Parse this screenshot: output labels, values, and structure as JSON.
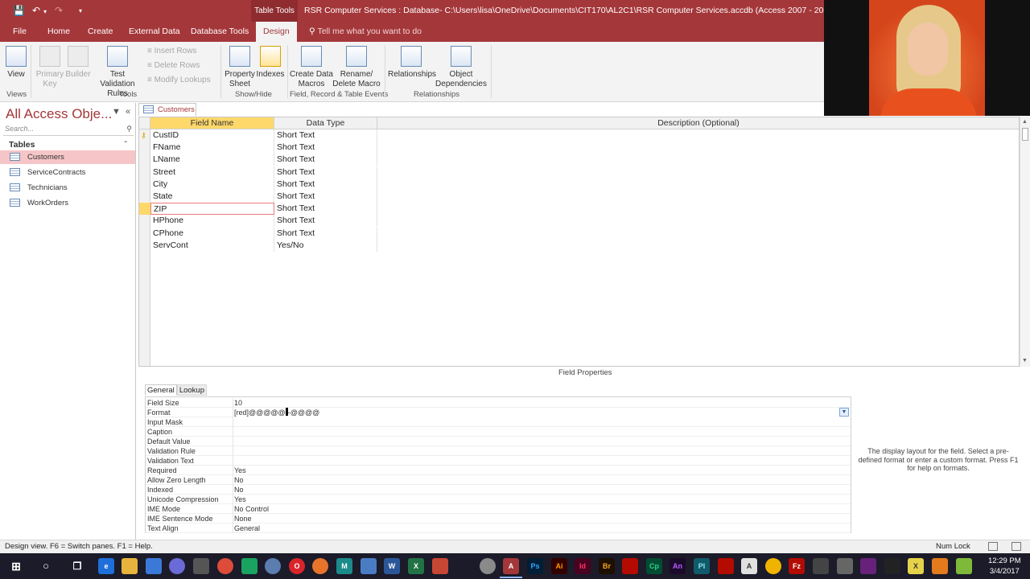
{
  "title_bar": {
    "context_tab": "Table Tools",
    "title": "RSR Computer Services : Database- C:\\Users\\lisa\\OneDrive\\Documents\\CIT170\\AL2C1\\RSR Computer Services.accdb (Access 2007 - 2016 file format) - Ac"
  },
  "ribbon_tabs": [
    "File",
    "Home",
    "Create",
    "External Data",
    "Database Tools",
    "Design"
  ],
  "tell_me": "Tell me what you want to do",
  "ribbon": {
    "view": "View",
    "primary_key": "Primary Key",
    "builder": "Builder",
    "test_validation": "Test Validation Rules",
    "insert_rows": "Insert Rows",
    "delete_rows": "Delete Rows",
    "modify_lookups": "Modify Lookups",
    "property_sheet": "Property Sheet",
    "indexes": "Indexes",
    "create_data_macros": "Create Data Macros",
    "rename_delete_macro": "Rename/ Delete Macro",
    "relationships": "Relationships",
    "object_dependencies": "Object Dependencies",
    "groups": {
      "views": "Views",
      "tools": "Tools",
      "show_hide": "Show/Hide",
      "events": "Field, Record & Table Events",
      "relationships": "Relationships"
    }
  },
  "nav": {
    "title": "All Access Obje...",
    "search_placeholder": "Search...",
    "section": "Tables",
    "items": [
      "Customers",
      "ServiceContracts",
      "Technicians",
      "WorkOrders"
    ],
    "selected": "Customers"
  },
  "doc_tab": "Customers",
  "grid": {
    "headers": [
      "Field Name",
      "Data Type",
      "Description (Optional)"
    ],
    "rows": [
      {
        "name": "CustID",
        "type": "Short Text"
      },
      {
        "name": "FName",
        "type": "Short Text"
      },
      {
        "name": "LName",
        "type": "Short Text"
      },
      {
        "name": "Street",
        "type": "Short Text"
      },
      {
        "name": "City",
        "type": "Short Text"
      },
      {
        "name": "State",
        "type": "Short Text"
      },
      {
        "name": "ZIP",
        "type": "Short Text"
      },
      {
        "name": "HPhone",
        "type": "Short Text"
      },
      {
        "name": "CPhone",
        "type": "Short Text"
      },
      {
        "name": "ServCont",
        "type": "Yes/No"
      }
    ],
    "current_row": "ZIP"
  },
  "field_properties": {
    "title": "Field Properties",
    "tabs": [
      "General",
      "Lookup"
    ],
    "props": [
      {
        "label": "Field Size",
        "value": "10"
      },
      {
        "label": "Format",
        "value": "[red]@@@@@-@@@@"
      },
      {
        "label": "Input Mask",
        "value": ""
      },
      {
        "label": "Caption",
        "value": ""
      },
      {
        "label": "Default Value",
        "value": ""
      },
      {
        "label": "Validation Rule",
        "value": ""
      },
      {
        "label": "Validation Text",
        "value": ""
      },
      {
        "label": "Required",
        "value": "Yes"
      },
      {
        "label": "Allow Zero Length",
        "value": "No"
      },
      {
        "label": "Indexed",
        "value": "No"
      },
      {
        "label": "Unicode Compression",
        "value": "Yes"
      },
      {
        "label": "IME Mode",
        "value": "No Control"
      },
      {
        "label": "IME Sentence Mode",
        "value": "None"
      },
      {
        "label": "Text Align",
        "value": "General"
      }
    ],
    "help": "The display layout for the field. Select a pre-defined format or enter a custom format. Press F1 for help on formats."
  },
  "status": {
    "left": "Design view.  F6 = Switch panes.  F1 = Help.",
    "num_lock": "Num Lock"
  },
  "clock": {
    "time": "12:29 PM",
    "date": "3/4/2017"
  }
}
